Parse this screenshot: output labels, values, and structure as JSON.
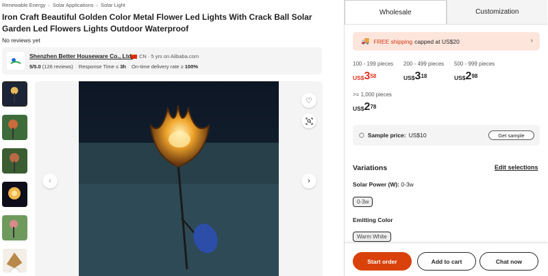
{
  "breadcrumb": [
    "Renewable Energy",
    "Solar Applications",
    "Solar Light"
  ],
  "product": {
    "title": "Iron Craft Beautiful Golden Color Metal Flower Led Lights With Crack Ball Solar Garden Led Flowers Lights Outdoor Waterproof",
    "reviews": "No reviews yet"
  },
  "supplier": {
    "name": "Shenzhen Better Houseware Co., Ltd.",
    "country": "CN · 5 yrs on Alibaba.com",
    "rating": "5/5.0",
    "rating_count": "(126 reviews)",
    "response_label": "Response Time ≤",
    "response_value": "3h",
    "delivery_label": "On-time delivery rate ≥",
    "delivery_value": "100%"
  },
  "tabs": {
    "wholesale": "Wholesale",
    "customization": "Customization"
  },
  "shipping": {
    "free": "FREE shipping",
    "rest": "capped at US$20"
  },
  "tiers": [
    {
      "range": "100 - 199 pieces",
      "currency": "US$",
      "whole": "3",
      "decimal": "58"
    },
    {
      "range": "200 - 499 pieces",
      "currency": "US$",
      "whole": "3",
      "decimal": "18"
    },
    {
      "range": "500 - 999 pieces",
      "currency": "US$",
      "whole": "2",
      "decimal": "98"
    },
    {
      "range": ">= 1,000 pieces",
      "currency": "US$",
      "whole": "2",
      "decimal": "78"
    }
  ],
  "sample": {
    "label": "Sample price:",
    "value": "US$10",
    "button": "Get sample"
  },
  "variations": {
    "title": "Variations",
    "edit": "Edit selections",
    "solar_power_label": "Solar Power (W):",
    "solar_power_value": "0-3w",
    "solar_power_option": "0-3w",
    "color_label": "Emitting Color",
    "color_option": "Warm White"
  },
  "actions": {
    "start_order": "Start order",
    "add_to_cart": "Add to cart",
    "chat_now": "Chat now"
  },
  "colors": {
    "accent": "#d9420b",
    "price_red": "#e0301e"
  },
  "icons": {
    "prev": "chevron-left-icon",
    "next": "chevron-right-icon",
    "favorite": "heart-icon",
    "visual_search": "image-search-icon",
    "shipping": "truck-icon",
    "sample": "box-icon",
    "more": "chevron-down-icon"
  }
}
